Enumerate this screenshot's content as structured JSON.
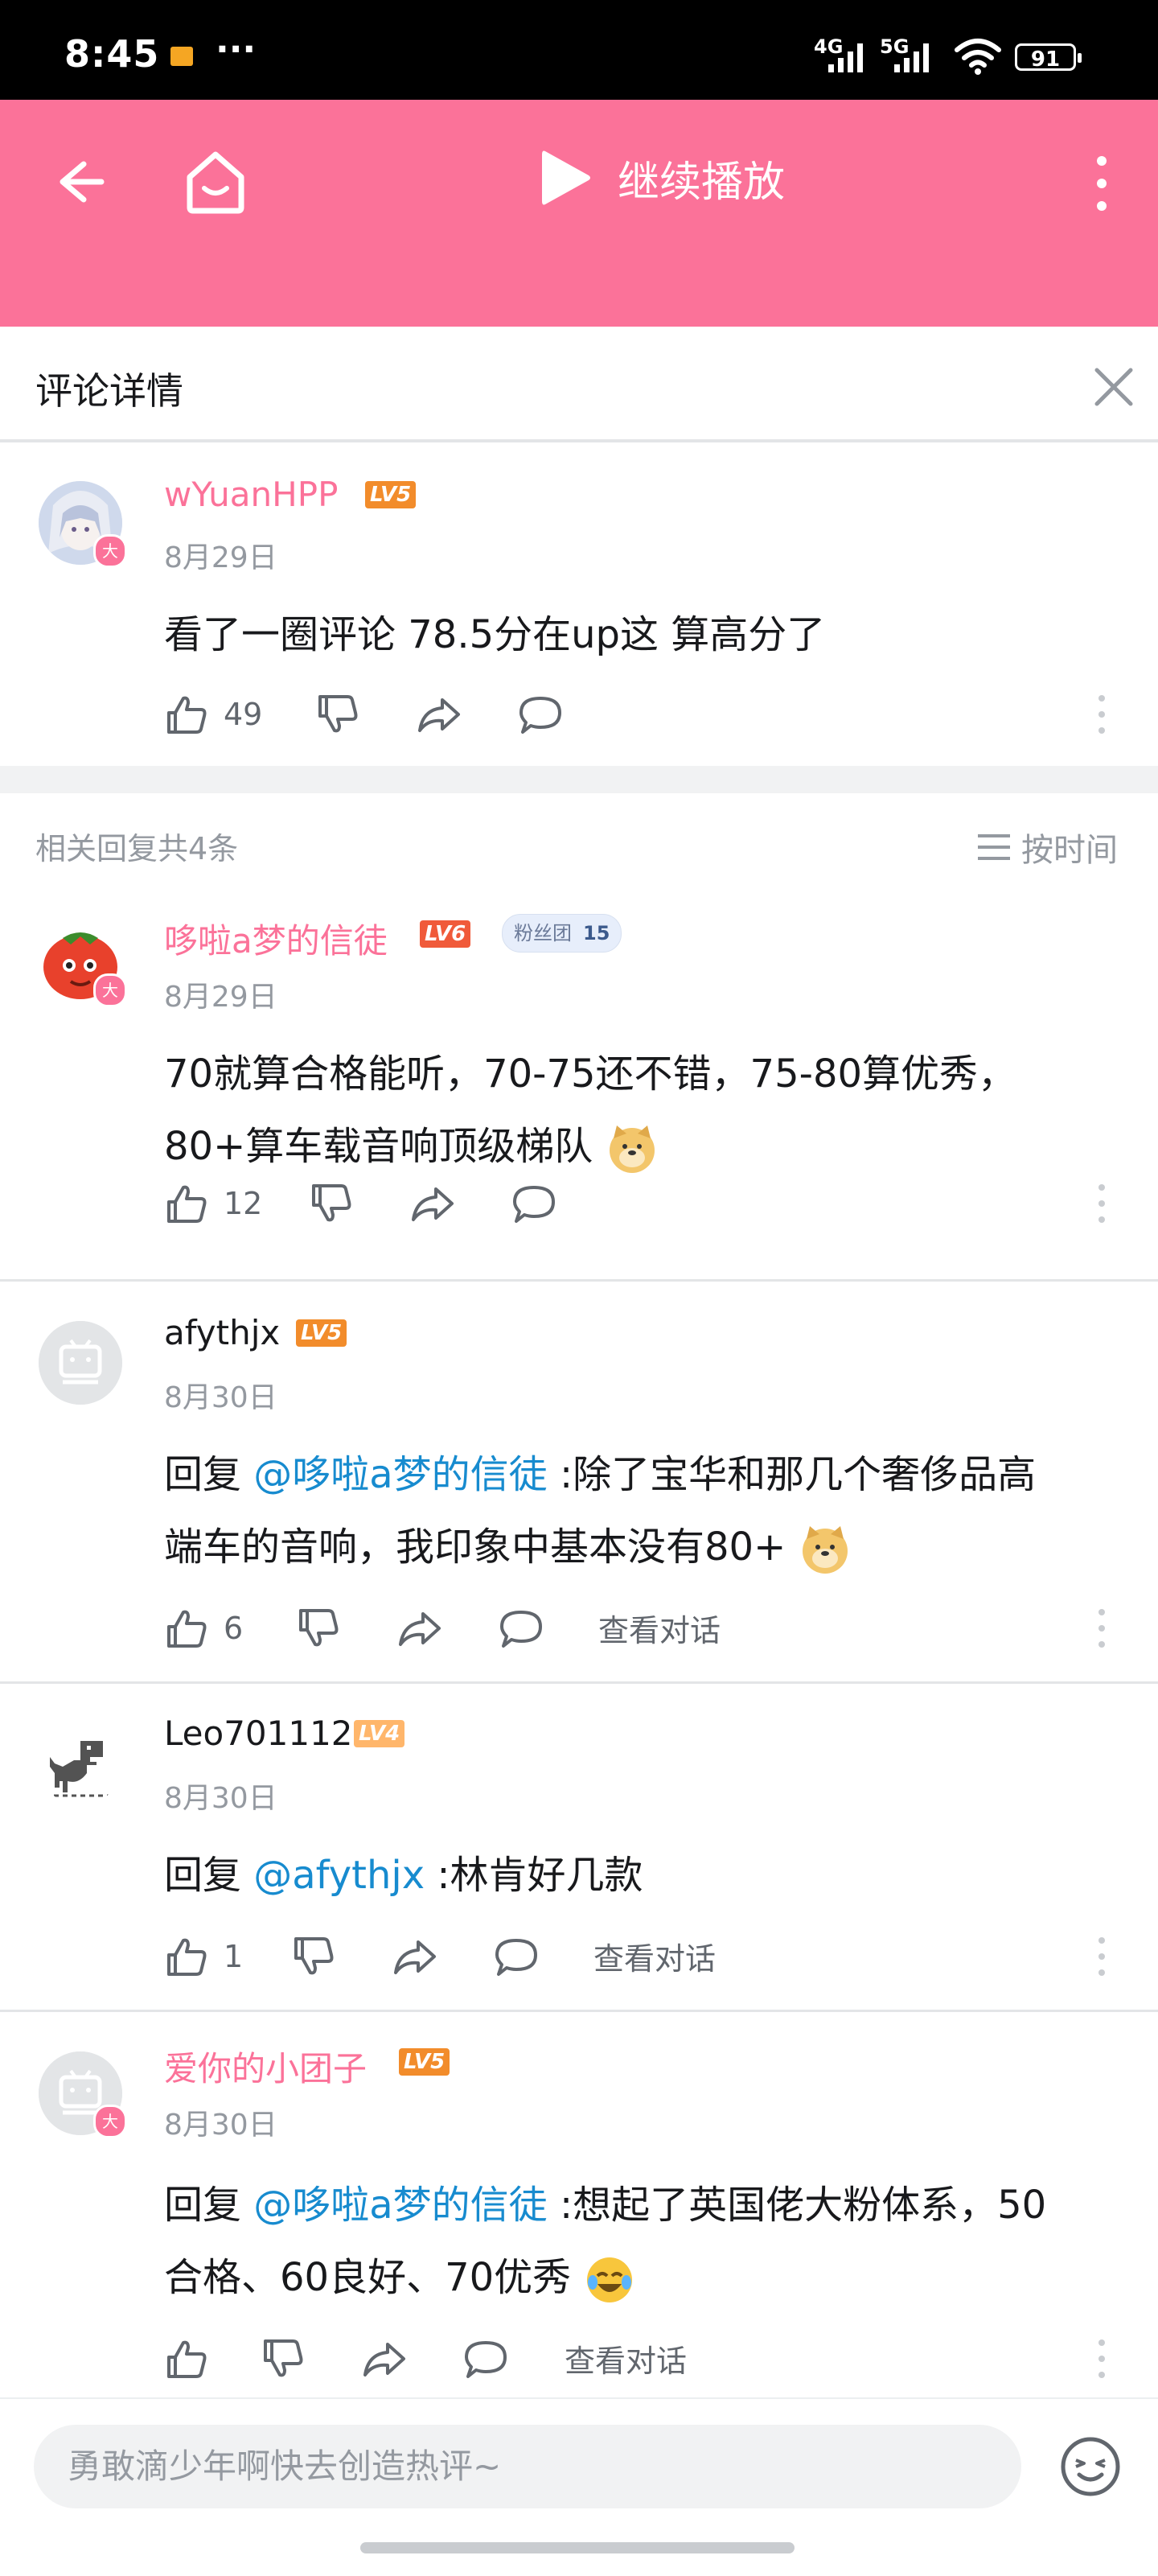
{
  "status_bar": {
    "time": "8:45",
    "dots": "···",
    "net1": "4G",
    "net2": "5G",
    "battery": "91"
  },
  "top_bar": {
    "play_label": "继续播放"
  },
  "sheet": {
    "title": "评论详情"
  },
  "main_comment": {
    "user": "wYuanHPP",
    "level": "LV5",
    "date": "8月29日",
    "text": "看了一圈评论 78.5分在up这 算高分了",
    "likes": "49"
  },
  "replies_header": {
    "count_label": "相关回复共4条",
    "sort_label": "按时间"
  },
  "replies": [
    {
      "user": "哆啦a梦的信徒",
      "level": "LV6",
      "fan_label": "粉丝团",
      "fan_level": "15",
      "date": "8月29日",
      "line1": "70就算合格能听，70-75还不错，75-80算优秀，",
      "line2": "80+算车载音响顶级梯队",
      "likes": "12"
    },
    {
      "user": "afythjx",
      "level": "LV5",
      "date": "8月30日",
      "prefix": "回复 ",
      "at": "@哆啦a梦的信徒",
      "line1": " :除了宝华和那几个奢侈品高",
      "line2": "端车的音响，我印象中基本没有80+",
      "likes": "6",
      "view": "查看对话"
    },
    {
      "user": "Leo701112",
      "level": "LV4",
      "date": "8月30日",
      "prefix": "回复 ",
      "at": "@afythjx",
      "line1": " :林肯好几款",
      "likes": "1",
      "view": "查看对话"
    },
    {
      "user": "爱你的小团子",
      "level": "LV5",
      "date": "8月30日",
      "prefix": "回复 ",
      "at": "@哆啦a梦的信徒",
      "line1": " :想起了英国佬大粉体系，50",
      "line2": "合格、60良好、70优秀",
      "view": "查看对话"
    }
  ],
  "avatar_badge": "大",
  "composer": {
    "placeholder": "勇敢滴少年啊快去创造热评~"
  },
  "colors": {
    "brand": "#fb7299",
    "vip_name": "#fb7299",
    "link": "#178bcf",
    "lv5": "#f28c2b",
    "lv6": "#f05a3a",
    "lv4": "#ffb66b"
  }
}
